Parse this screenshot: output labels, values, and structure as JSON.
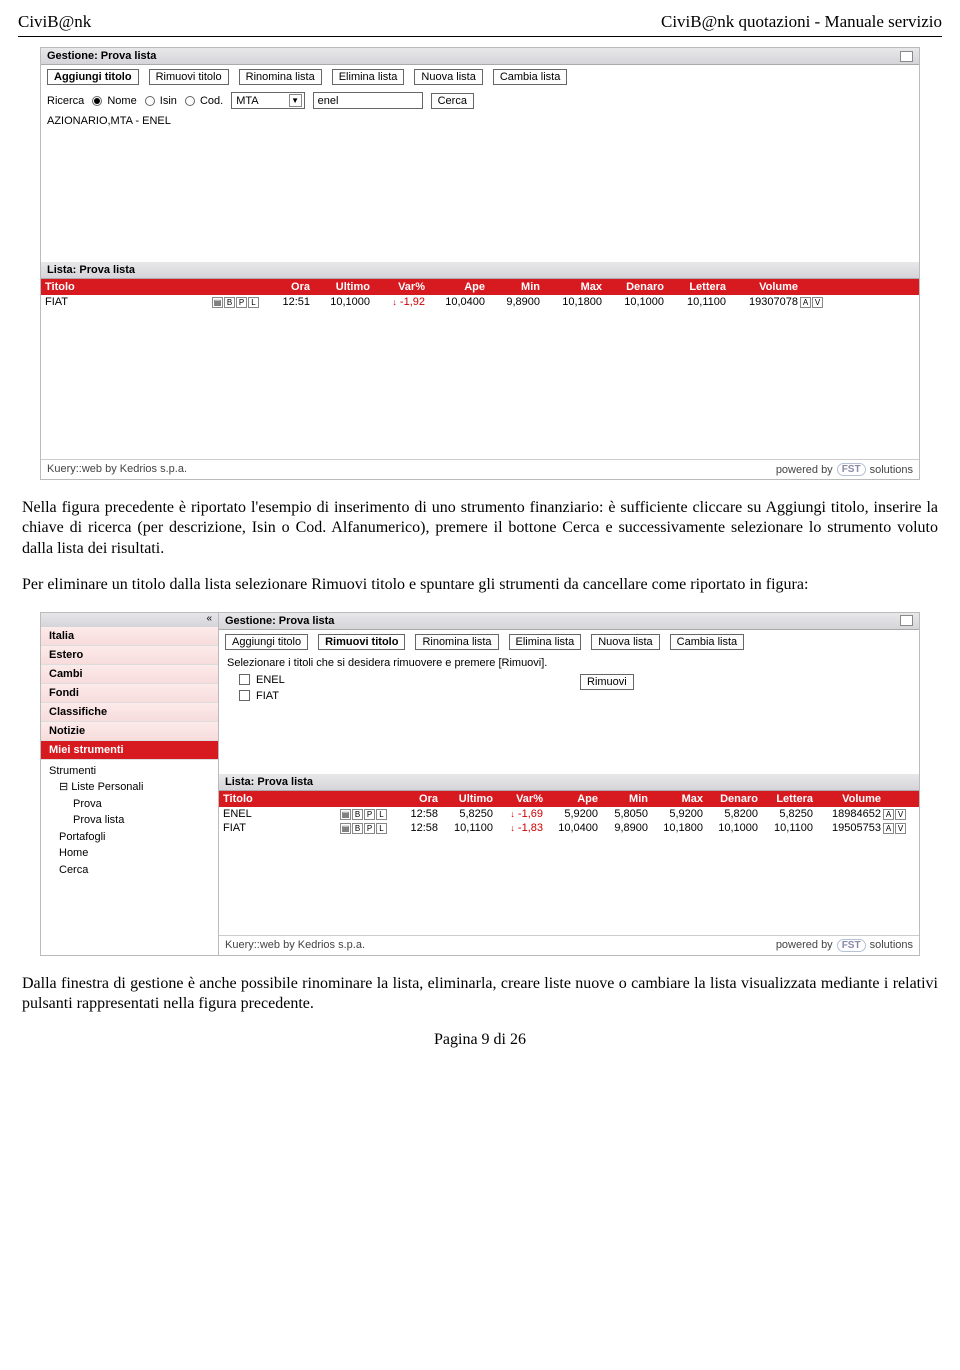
{
  "header": {
    "left": "CiviB@nk",
    "right": "CiviB@nk quotazioni - Manuale servizio"
  },
  "fig1": {
    "gestione_title": "Gestione: Prova lista",
    "buttons": [
      "Aggiungi titolo",
      "Rimuovi titolo",
      "Rinomina lista",
      "Elimina lista",
      "Nuova lista",
      "Cambia lista"
    ],
    "search": {
      "label": "Ricerca",
      "opts": [
        "Nome",
        "Isin",
        "Cod."
      ],
      "selected": "Nome",
      "dropdown": "MTA",
      "input_value": "enel",
      "go": "Cerca"
    },
    "result_row": "AZIONARIO,MTA - ENEL",
    "lista_title": "Lista: Prova lista",
    "cols": [
      "Titolo",
      "Ora",
      "Ultimo",
      "Var%",
      "Ape",
      "Min",
      "Max",
      "Denaro",
      "Lettera",
      "Volume"
    ],
    "row": {
      "titolo": "FIAT",
      "ora": "12:51",
      "ultimo": "10,1000",
      "var": "-1,92",
      "ape": "10,0400",
      "min": "9,8900",
      "max": "10,1800",
      "denaro": "10,1000",
      "lettera": "10,1100",
      "volume": "19307078"
    },
    "footer_left": "Kuery::web by Kedrios s.p.a.",
    "footer_right": "powered by",
    "fst": "FST",
    "fst2": "solutions"
  },
  "para1": "Nella figura precedente è riportato l'esempio di inserimento di uno strumento finanziario: è sufficiente cliccare su Aggiungi titolo, inserire la chiave di ricerca (per descrizione, Isin o Cod. Alfanumerico), premere il bottone Cerca e successivamente selezionare lo strumento voluto dalla lista dei risultati.",
  "para2": "Per eliminare un titolo dalla lista selezionare Rimuovi titolo e spuntare gli strumenti da cancellare come riportato in figura:",
  "fig2": {
    "sidebar": {
      "items": [
        "Italia",
        "Estero",
        "Cambi",
        "Fondi",
        "Classifiche",
        "Notizie"
      ],
      "red": "Miei strumenti",
      "tree": {
        "root": "Strumenti",
        "branch": "Liste Personali",
        "leaves": [
          "Prova",
          "Prova lista"
        ],
        "others": [
          "Portafogli",
          "Home",
          "Cerca"
        ]
      }
    },
    "gestione_title": "Gestione: Prova lista",
    "buttons": [
      "Aggiungi titolo",
      "Rimuovi titolo",
      "Rinomina lista",
      "Elimina lista",
      "Nuova lista",
      "Cambia lista"
    ],
    "instr": "Selezionare i titoli che si desidera rimuovere e premere [Rimuovi].",
    "remove": "Rimuovi",
    "checks": [
      "ENEL",
      "FIAT"
    ],
    "lista_title": "Lista: Prova lista",
    "cols": [
      "Titolo",
      "Ora",
      "Ultimo",
      "Var%",
      "Ape",
      "Min",
      "Max",
      "Denaro",
      "Lettera",
      "Volume"
    ],
    "rows": [
      {
        "titolo": "ENEL",
        "ora": "12:58",
        "ultimo": "5,8250",
        "var": "-1,69",
        "ape": "5,9200",
        "min": "5,8050",
        "max": "5,9200",
        "denaro": "5,8200",
        "lettera": "5,8250",
        "volume": "18984652"
      },
      {
        "titolo": "FIAT",
        "ora": "12:58",
        "ultimo": "10,1100",
        "var": "-1,83",
        "ape": "10,0400",
        "min": "9,8900",
        "max": "10,1800",
        "denaro": "10,1000",
        "lettera": "10,1100",
        "volume": "19505753"
      }
    ],
    "footer_left": "Kuery::web by Kedrios s.p.a.",
    "footer_right": "powered by",
    "fst": "FST",
    "fst2": "solutions"
  },
  "para3": "Dalla finestra di gestione è anche possibile rinominare la lista, eliminarla, creare liste nuove o cambiare la lista visualizzata mediante i relativi pulsanti rappresentati nella figura precedente.",
  "pagenum": "Pagina 9 di 26"
}
